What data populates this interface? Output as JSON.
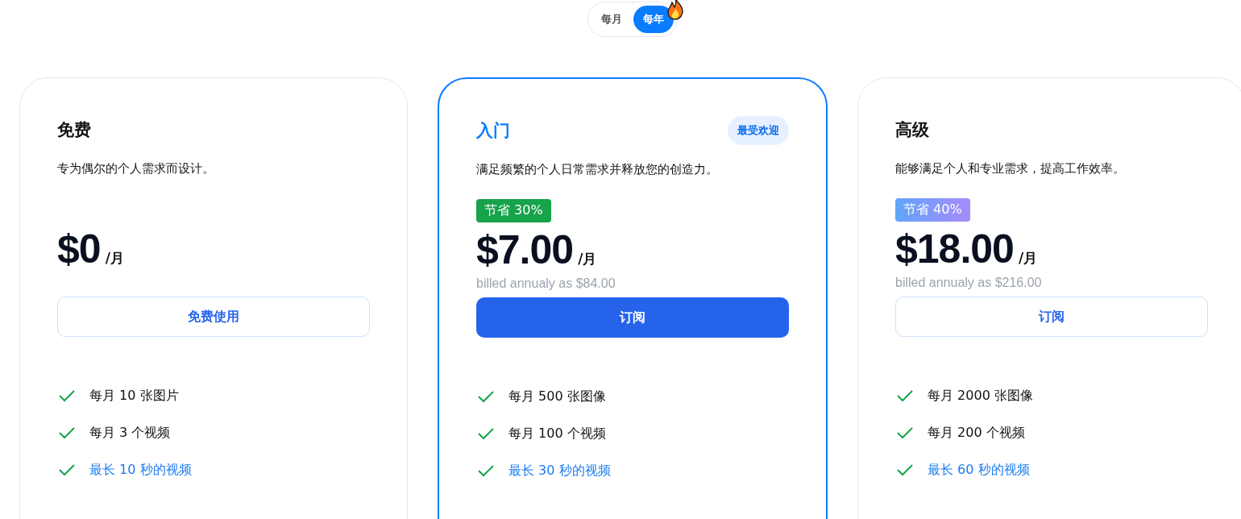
{
  "billing_toggle": [
    {
      "label": "每月",
      "selected": false
    },
    {
      "label": "每年",
      "selected": true
    }
  ],
  "plans": [
    {
      "name": "免费",
      "featured": false,
      "description": "专为偶尔的个人需求而设计。",
      "price": "$0",
      "unit": "/月",
      "button": {
        "label": "免费使用",
        "kind": "outline"
      },
      "features": [
        {
          "text": "每月 10 张图片",
          "kind": "plain"
        },
        {
          "text": "每月 3 个视频",
          "kind": "plain"
        },
        {
          "text": "最长 10 秒的视频",
          "kind": "link"
        }
      ]
    },
    {
      "name": "入门",
      "featured": true,
      "badge": "最受欢迎",
      "description": "满足频繁的个人日常需求并释放您的创造力。",
      "savings": {
        "text": "节省 30%",
        "kind": "green"
      },
      "price": "$7.00",
      "unit": "/月",
      "billed": "billed annualy as $84.00",
      "button": {
        "label": "订阅",
        "kind": "primary"
      },
      "features": [
        {
          "text": "每月 500 张图像",
          "kind": "plain"
        },
        {
          "text": "每月 100 个视频",
          "kind": "plain"
        },
        {
          "text": "最长 30 秒的视频",
          "kind": "link"
        }
      ]
    },
    {
      "name": "高级",
      "featured": false,
      "description": "能够满足个人和专业需求，提高工作效率。",
      "savings": {
        "text": "节省 40%",
        "kind": "gradient"
      },
      "price": "$18.00",
      "unit": "/月",
      "billed": "billed annualy as $216.00",
      "button": {
        "label": "订阅",
        "kind": "outline"
      },
      "features": [
        {
          "text": "每月 2000 张图像",
          "kind": "plain"
        },
        {
          "text": "每月 200 个视频",
          "kind": "plain"
        },
        {
          "text": "最长 60 秒的视频",
          "kind": "link"
        }
      ]
    }
  ]
}
